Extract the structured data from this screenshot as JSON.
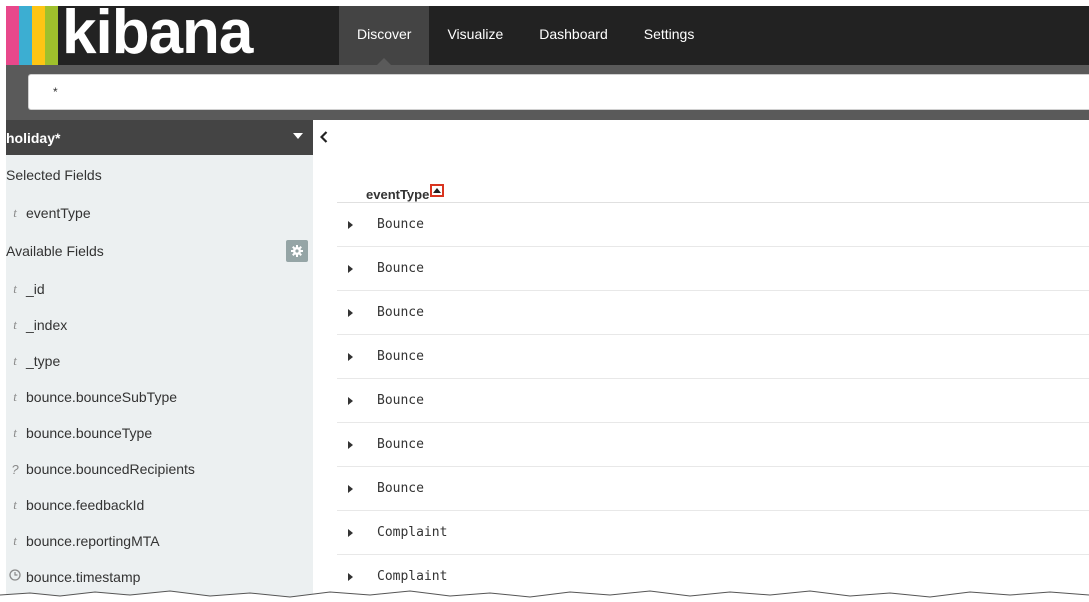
{
  "app": {
    "logo_text": "kibana",
    "logo_bar_colors": [
      "#e8488b",
      "#3caed2",
      "#fec514",
      "#9fc02c"
    ],
    "accent": "#d9341f"
  },
  "nav": {
    "tabs": [
      {
        "label": "Discover",
        "active": true
      },
      {
        "label": "Visualize",
        "active": false
      },
      {
        "label": "Dashboard",
        "active": false
      },
      {
        "label": "Settings",
        "active": false
      }
    ]
  },
  "search": {
    "value": "*"
  },
  "sidebar": {
    "index_pattern": "holiday*",
    "selected_title": "Selected Fields",
    "selected_fields": [
      {
        "type_icon": "t",
        "name": "eventType"
      }
    ],
    "available_title": "Available Fields",
    "available_fields": [
      {
        "type_icon": "t",
        "name": "_id"
      },
      {
        "type_icon": "t",
        "name": "_index"
      },
      {
        "type_icon": "t",
        "name": "_type"
      },
      {
        "type_icon": "t",
        "name": "bounce.bounceSubType"
      },
      {
        "type_icon": "t",
        "name": "bounce.bounceType"
      },
      {
        "type_icon": "?",
        "name": "bounce.bouncedRecipients"
      },
      {
        "type_icon": "t",
        "name": "bounce.feedbackId"
      },
      {
        "type_icon": "t",
        "name": "bounce.reportingMTA"
      },
      {
        "type_icon": "clock",
        "name": "bounce.timestamp"
      }
    ]
  },
  "table": {
    "column": "eventType",
    "rows": [
      "Bounce",
      "Bounce",
      "Bounce",
      "Bounce",
      "Bounce",
      "Bounce",
      "Bounce",
      "Complaint",
      "Complaint"
    ]
  }
}
